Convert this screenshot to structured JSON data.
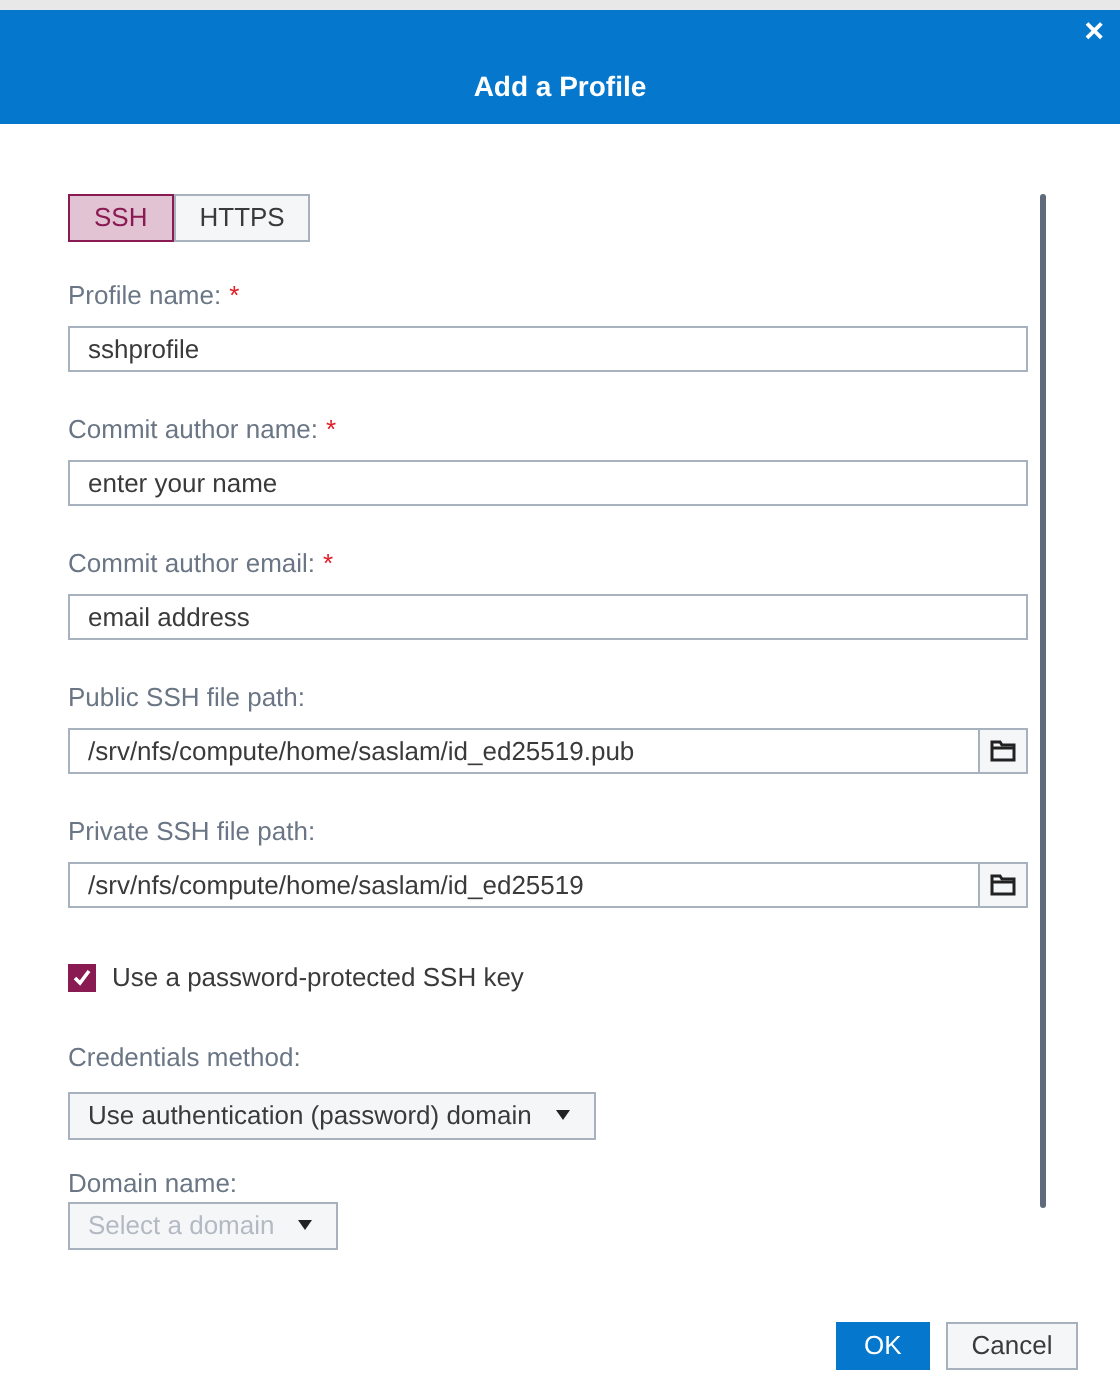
{
  "dialog": {
    "title": "Add a Profile",
    "close": "×"
  },
  "tabs": [
    {
      "label": "SSH",
      "selected": true
    },
    {
      "label": "HTTPS",
      "selected": false
    }
  ],
  "fields": [
    {
      "kind": "text",
      "label": "Profile name:",
      "required_mark": "*",
      "value": "sshprofile"
    },
    {
      "kind": "text",
      "label": "Commit author name:",
      "required_mark": "*",
      "placeholder": "enter your name"
    },
    {
      "kind": "text",
      "label": "Commit author email:",
      "required_mark": "*",
      "placeholder": "email address"
    },
    {
      "kind": "file",
      "label": "Public SSH file path:",
      "value": "/srv/nfs/compute/home/saslam/id_ed25519.pub"
    },
    {
      "kind": "file",
      "label": "Private SSH file path:",
      "value": "/srv/nfs/compute/home/saslam/id_ed25519"
    },
    {
      "kind": "checkbox",
      "label": "Use a password-protected SSH key",
      "checked": true
    },
    {
      "kind": "select",
      "label": "Credentials method:",
      "value": "Use authentication (password) domain",
      "disabled": false
    },
    {
      "kind": "select",
      "label": "Domain name:",
      "value": "Select a domain",
      "disabled": true
    }
  ],
  "buttons": [
    {
      "label": "OK",
      "primary": true
    },
    {
      "label": "Cancel",
      "primary": false
    }
  ]
}
